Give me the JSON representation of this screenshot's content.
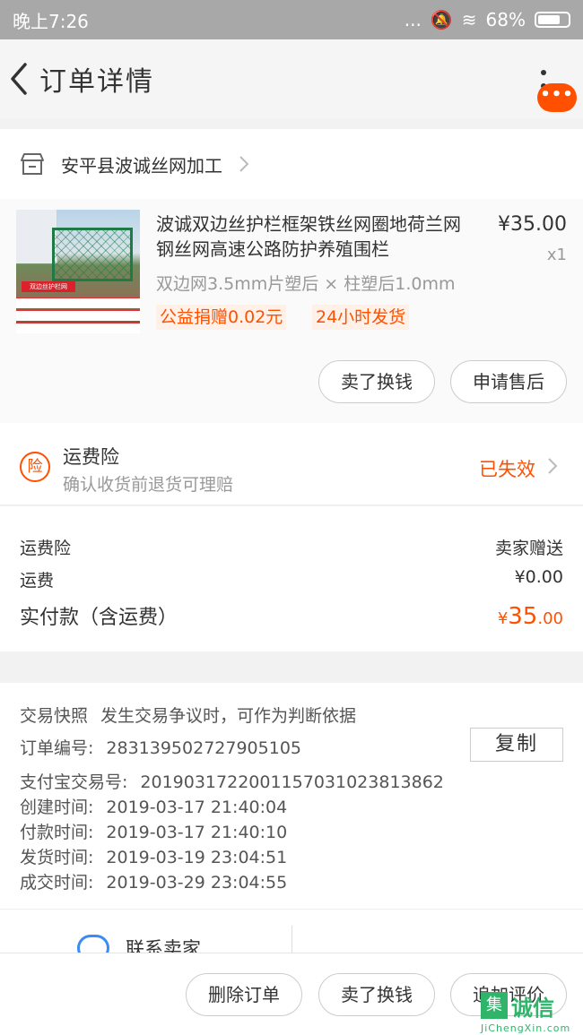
{
  "status_bar": {
    "time": "晚上7:26",
    "signal": "...",
    "battery": "68%"
  },
  "nav": {
    "title": "订单详情",
    "message_badge": "•••"
  },
  "shop": {
    "name": "安平县波诚丝网加工"
  },
  "product": {
    "title": "波诚双边丝护栏框架铁丝网圈地荷兰网钢丝网高速公路防护养殖围栏",
    "sku": "双边网3.5mm片塑后 × 柱塑后1.0mm",
    "price": "¥35.00",
    "quantity": "x1",
    "tags": [
      "公益捐赠0.02元",
      "24小时发货"
    ],
    "image_caption": "双边丝护栏网"
  },
  "item_actions": {
    "sell": "卖了换钱",
    "after_sale": "申请售后"
  },
  "insurance": {
    "title": "运费险",
    "subtitle": "确认收货前退货可理赔",
    "status": "已失效",
    "icon_text": "险"
  },
  "fees": {
    "insurance_label": "运费险",
    "insurance_value": "卖家赠送",
    "shipping_label": "运费",
    "shipping_value": "¥0.00",
    "paid_label": "实付款（含运费）",
    "paid_symbol": "¥",
    "paid_integer": "35",
    "paid_decimal": ".00"
  },
  "order_info": {
    "snapshot_label": "交易快照",
    "snapshot_note": "发生交易争议时，可作为判断依据",
    "order_no_label": "订单编号:",
    "order_no": "283139502727905105",
    "copy_label": "复制",
    "alipay_label": "支付宝交易号:",
    "alipay_no": "2019031722001157031023813862",
    "created_label": "创建时间:",
    "created": "2019-03-17 21:40:04",
    "paid_time_label": "付款时间:",
    "paid_time": "2019-03-17 21:40:10",
    "shipped_label": "发货时间:",
    "shipped": "2019-03-19 23:04:51",
    "completed_label": "成交时间:",
    "completed": "2019-03-29 23:04:55"
  },
  "contact": {
    "label": "联系卖家"
  },
  "bottom_actions": {
    "delete": "删除订单",
    "sell": "卖了换钱",
    "review": "追加评价"
  },
  "watermark": {
    "box": "集",
    "text": "诚信",
    "sub": "JiChengXin.com"
  },
  "colors": {
    "accent": "#ff5000",
    "contact_blue": "#3b8bf5",
    "watermark_green": "#2fb46a"
  }
}
